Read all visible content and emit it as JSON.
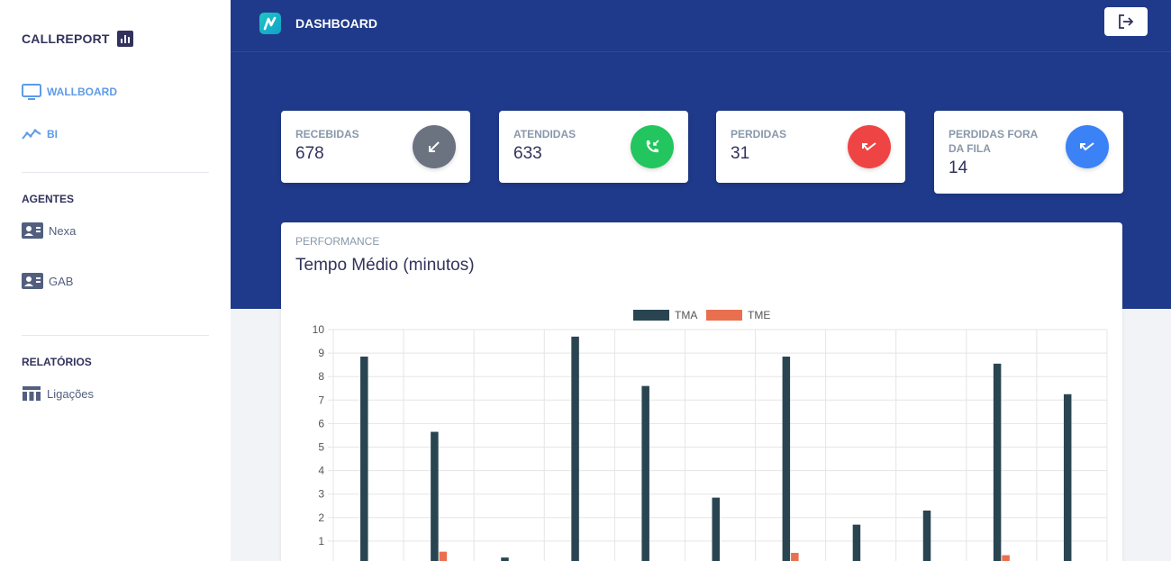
{
  "sidebar": {
    "brand": "CALLREPORT",
    "nav": {
      "wallboard": "WALLBOARD",
      "bi": "BI"
    },
    "agents_heading": "AGENTES",
    "agents": [
      "Nexa",
      "GAB"
    ],
    "reports_heading": "RELATÓRIOS",
    "reports": [
      "Ligações"
    ]
  },
  "header": {
    "title": "DASHBOARD"
  },
  "stats": [
    {
      "label": "RECEBIDAS",
      "value": "678",
      "color": "#6b7280",
      "icon": "arrow-down-left-icon"
    },
    {
      "label": "ATENDIDAS",
      "value": "633",
      "color": "#22c55e",
      "icon": "phone-incoming-icon"
    },
    {
      "label": "PERDIDAS",
      "value": "31",
      "color": "#ef4444",
      "icon": "missed-call-icon"
    },
    {
      "label": "PERDIDAS FORA DA FILA",
      "value": "14",
      "color": "#3b82f6",
      "icon": "missed-call-icon"
    }
  ],
  "performance": {
    "subtitle": "PERFORMANCE",
    "title": "Tempo Médio (minutos)"
  },
  "chart_data": {
    "type": "bar",
    "categories": [
      "",
      "",
      "",
      "",
      "",
      "",
      "",
      "",
      "",
      "",
      ""
    ],
    "series": [
      {
        "name": "TMA",
        "color": "#2a4552",
        "values": [
          8.85,
          5.65,
          0.3,
          9.7,
          7.6,
          2.85,
          8.85,
          1.7,
          2.3,
          8.55,
          7.25
        ]
      },
      {
        "name": "TME",
        "color": "#e8704f",
        "values": [
          0.05,
          0.55,
          0,
          0,
          0.1,
          0,
          0.5,
          0,
          0,
          0.4,
          0
        ]
      }
    ],
    "ylim": [
      0,
      10
    ],
    "yticks": [
      "1",
      "2",
      "3",
      "4",
      "5",
      "6",
      "7",
      "8",
      "9",
      "10"
    ],
    "grid": true,
    "legend": "top"
  }
}
